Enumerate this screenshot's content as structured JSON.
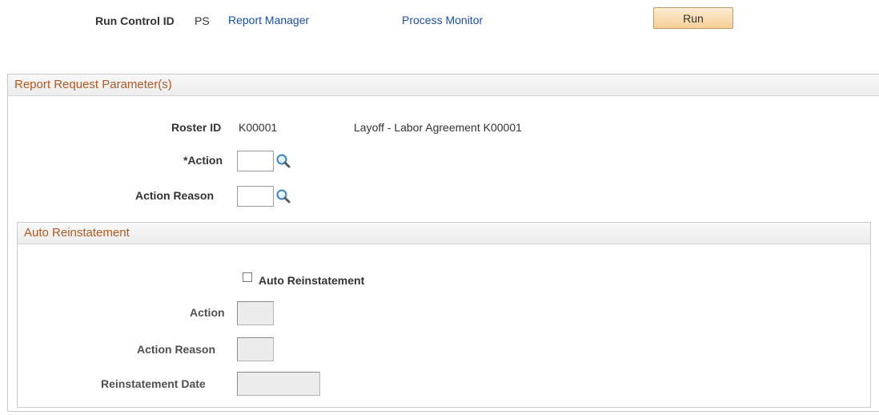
{
  "toolbar": {
    "run_control_label": "Run Control ID",
    "run_control_value": "PS",
    "report_manager_link": "Report Manager",
    "process_monitor_link": "Process Monitor",
    "run_button": "Run"
  },
  "params": {
    "header": "Report Request Parameter(s)",
    "roster_label": "Roster ID",
    "roster_value": "K00001",
    "roster_desc": "Layoff - Labor Agreement K00001",
    "action_label": "*Action",
    "action_value": "",
    "action_reason_label": "Action Reason",
    "action_reason_value": ""
  },
  "auto": {
    "header": "Auto Reinstatement",
    "checkbox_label": "Auto Reinstatement",
    "checkbox_checked": false,
    "action_label": "Action",
    "action_value": "",
    "action_reason_label": "Action Reason",
    "action_reason_value": "",
    "date_label": "Reinstatement Date",
    "date_value": ""
  },
  "icons": {
    "lookup": "magnifier-icon"
  },
  "colors": {
    "section_title": "#b4571a",
    "link": "#1a4fa3",
    "button_top": "#fcecd2",
    "button_bottom": "#f6cf95"
  }
}
